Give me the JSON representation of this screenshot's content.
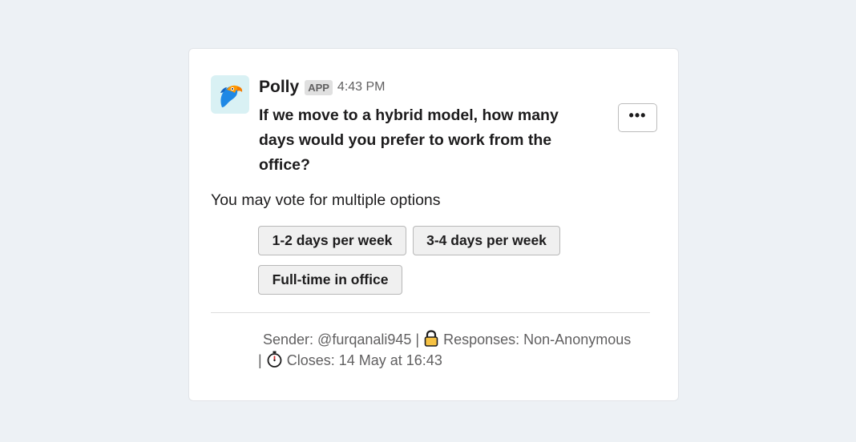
{
  "message": {
    "app_name": "Polly",
    "app_badge": "APP",
    "timestamp": "4:43 PM",
    "avatar_icon": "parrot-logo-icon",
    "question": "If we move to a hybrid model, how many days would you prefer to work from the office?",
    "more_actions_label": "•••",
    "subtitle": "You may vote for multiple options",
    "options": [
      {
        "label": "1-2 days per week"
      },
      {
        "label": "3-4 days per week"
      },
      {
        "label": "Full-time in office"
      }
    ],
    "footer": {
      "sender_text": "Sender: @furqanali945 |",
      "lock_icon": "lock-icon",
      "responses_text": "Responses: Non-Anonymous",
      "separator": "|",
      "clock_icon": "stopwatch-icon",
      "closes_text": "Closes: 14 May at 16:43"
    }
  },
  "colors": {
    "background": "#edf1f5",
    "card": "#ffffff",
    "text": "#1d1c1d",
    "muted": "#616061",
    "avatar_bg": "#d9f1f4",
    "parrot_blue": "#1e88e5",
    "parrot_orange": "#ff9800"
  }
}
